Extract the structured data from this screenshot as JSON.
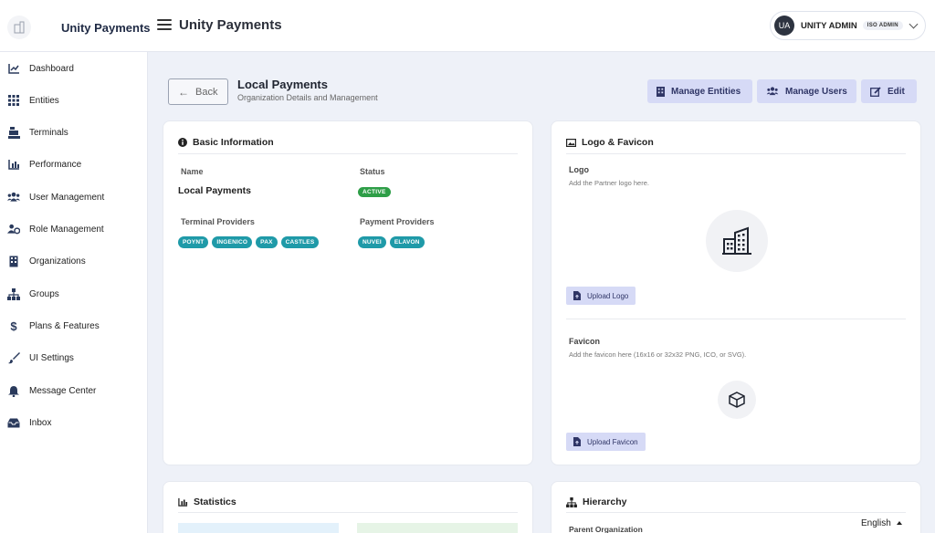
{
  "app": {
    "name": "Unity Payments",
    "title": "Unity Payments"
  },
  "user": {
    "initials": "UA",
    "name": "UNITY ADMIN",
    "role": "ISO ADMIN"
  },
  "sidebar": {
    "items": [
      {
        "label": "Dashboard",
        "icon": "chart-line-icon"
      },
      {
        "label": "Entities",
        "icon": "grid-icon"
      },
      {
        "label": "Terminals",
        "icon": "cash-register-icon"
      },
      {
        "label": "Performance",
        "icon": "bar-chart-icon"
      },
      {
        "label": "User Management",
        "icon": "users-icon"
      },
      {
        "label": "Role Management",
        "icon": "users-cog-icon"
      },
      {
        "label": "Organizations",
        "icon": "building-icon"
      },
      {
        "label": "Groups",
        "icon": "sitemap-icon"
      },
      {
        "label": "Plans & Features",
        "icon": "dollar-icon"
      },
      {
        "label": "UI Settings",
        "icon": "paint-brush-icon"
      },
      {
        "label": "Message Center",
        "icon": "bell-icon"
      },
      {
        "label": "Inbox",
        "icon": "inbox-icon"
      }
    ]
  },
  "header": {
    "back_label": "Back",
    "title": "Local Payments",
    "subtitle": "Organization Details and Management",
    "manage_entities": "Manage Entities",
    "manage_users": "Manage Users",
    "edit": "Edit"
  },
  "basic_info": {
    "title": "Basic Information",
    "name_label": "Name",
    "name_value": "Local Payments",
    "status_label": "Status",
    "status_value": "ACTIVE",
    "terminal_providers_label": "Terminal Providers",
    "terminal_providers": [
      "POYNT",
      "INGENICO",
      "PAX",
      "CASTLES"
    ],
    "payment_providers_label": "Payment Providers",
    "payment_providers": [
      "NUVEI",
      "ELAVON"
    ]
  },
  "logo_favicon": {
    "title": "Logo & Favicon",
    "logo_label": "Logo",
    "logo_desc": "Add the Partner logo here.",
    "upload_logo": "Upload Logo",
    "favicon_label": "Favicon",
    "favicon_desc": "Add the favicon here (16x16 or 32x32 PNG, ICO, or SVG).",
    "upload_favicon": "Upload Favicon"
  },
  "statistics": {
    "title": "Statistics"
  },
  "hierarchy": {
    "title": "Hierarchy",
    "parent_label": "Parent Organization"
  },
  "language": {
    "label": "English"
  },
  "colors": {
    "accent": "#d6daf6",
    "chip": "#1f9aa8",
    "active": "#2e9e47"
  }
}
